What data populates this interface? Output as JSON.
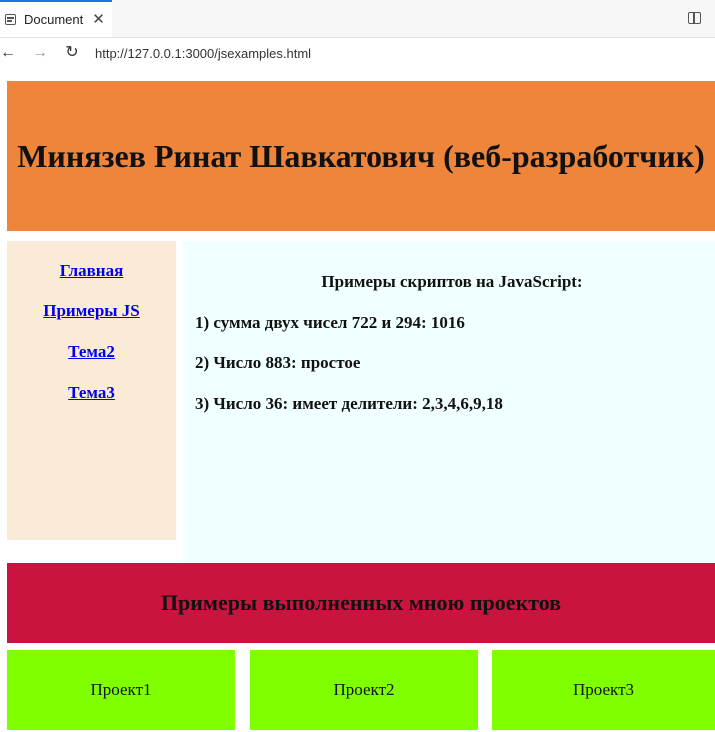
{
  "browser": {
    "tab_title": "Document",
    "tab_close": "✕",
    "url": "http://127.0.0.1:3000/jsexamples.html",
    "back_glyph": "←",
    "forward_glyph": "→",
    "reload_glyph": "↻"
  },
  "page": {
    "header_title": "Минязев Ринат Шавкатович (веб-разработчик)",
    "nav": [
      {
        "label": "Главная"
      },
      {
        "label": "Примеры JS"
      },
      {
        "label": "Тема2"
      },
      {
        "label": "Тема3"
      }
    ],
    "content": {
      "title": "Примеры скриптов на JavaScript:",
      "lines": [
        "1) сумма двух чисел 722 и 294: 1016",
        "2) Число 883: простое",
        "3) Число 36: имеет делители: 2,3,4,6,9,18"
      ]
    },
    "projects_heading": "Примеры выполненных мною проектов",
    "projects": [
      {
        "label": "Проект1"
      },
      {
        "label": "Проект2"
      },
      {
        "label": "Проект3"
      }
    ]
  },
  "colors": {
    "header_bg": "#ee853b",
    "sidebar_bg": "#faebd7",
    "content_bg": "#f0ffff",
    "projects_banner_bg": "#c8143f",
    "project_bg": "#7fff00",
    "link": "#0000ee"
  }
}
